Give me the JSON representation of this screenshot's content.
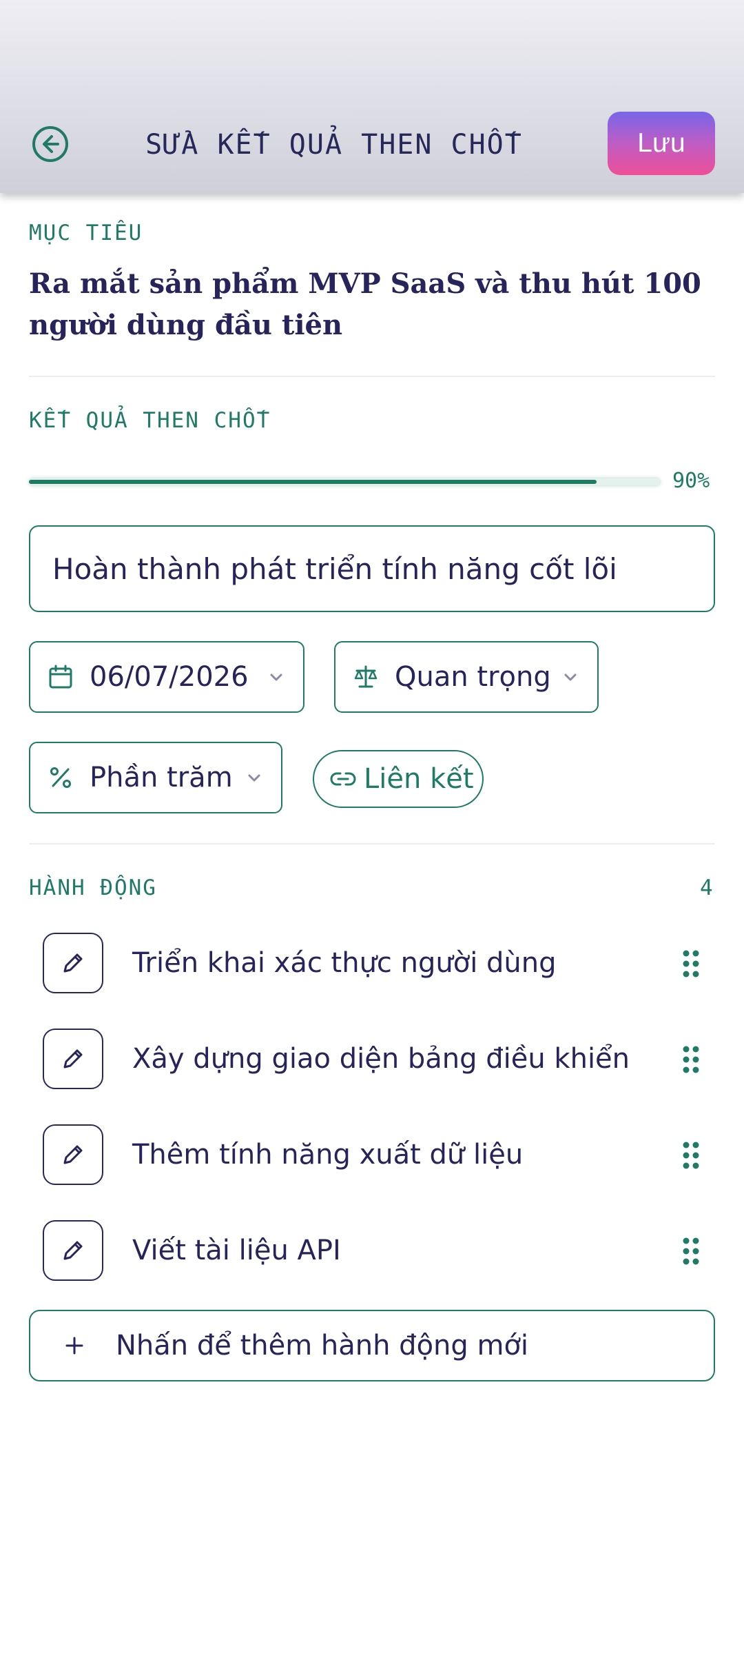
{
  "header": {
    "title": "SỬA KẾT QUẢ THEN CHỐT",
    "back_icon": "back-arrow-circle-icon",
    "save_label": "Lưu"
  },
  "objective": {
    "section_label": "MỤC TIÊU",
    "text": "Ra mắt sản phẩm MVP SaaS và thu hút 100 người dùng đầu tiên"
  },
  "key_result": {
    "section_label": "KẾT QUẢ THEN CHỐT",
    "progress_value": 0.9,
    "progress_label": "90%",
    "title_value": "Hoàn thành phát triển tính năng cốt lõi",
    "due_date": "06/07/2026",
    "priority": "Quan trọng",
    "measure_type": "Phần trăm",
    "link_label": "Liên kết"
  },
  "actions": {
    "section_label": "HÀNH ĐỘNG",
    "count": "4",
    "items": [
      {
        "label": "Triển khai xác thực người dùng"
      },
      {
        "label": "Xây dựng giao diện bảng điều khiển"
      },
      {
        "label": "Thêm tính năng xuất dữ liệu"
      },
      {
        "label": "Viết tài liệu API"
      }
    ],
    "add_label": "Nhấn để thêm hành động mới"
  },
  "colors": {
    "accent": "#1f7a66",
    "text_primary": "#26245a",
    "save_gradient_start": "#7866e9",
    "save_gradient_end": "#ee4f97"
  }
}
